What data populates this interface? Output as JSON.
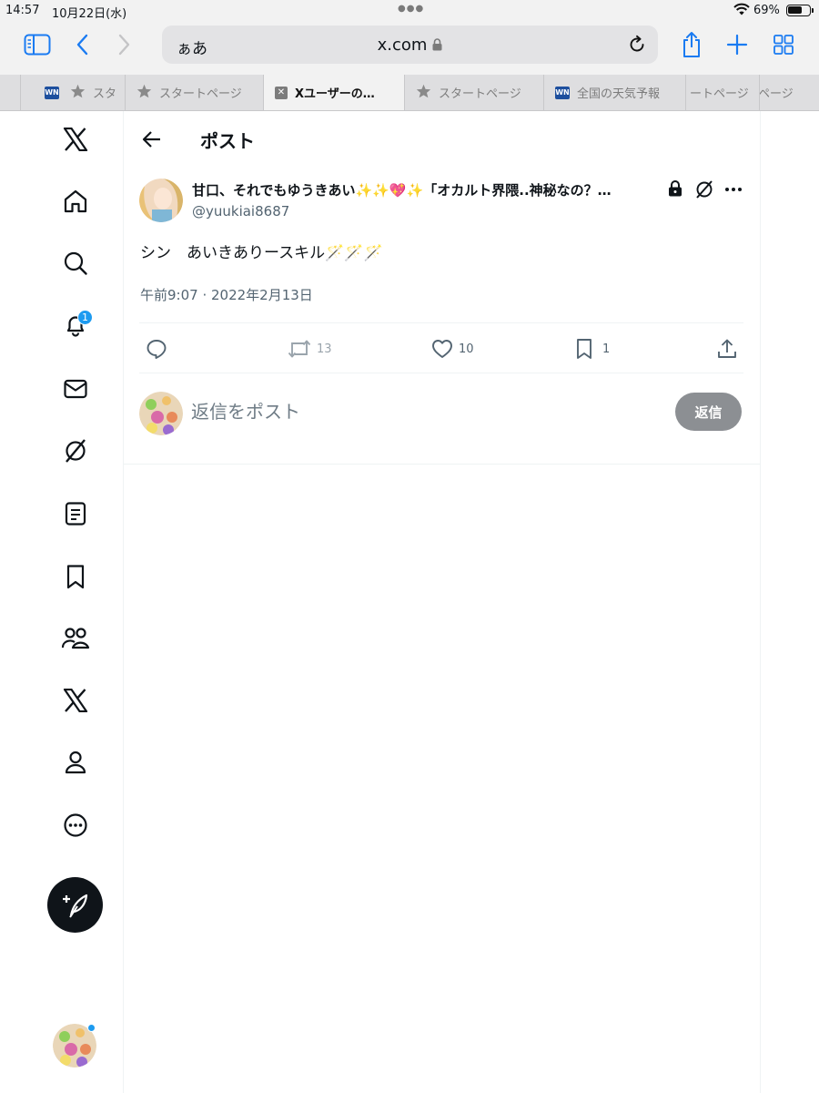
{
  "status_bar": {
    "time": "14:57",
    "date": "10月22日(水)",
    "battery_percent": "69%",
    "battery_level": 0.69
  },
  "browser": {
    "text_size_label": "ぁあ",
    "url": "x.com",
    "tabs": [
      {
        "label": "スタ",
        "favicon": "wn-icon"
      },
      {
        "label": "スタートページ",
        "favicon": "star-icon"
      },
      {
        "label": "Xユーザーの…",
        "favicon": "x-tab-icon",
        "active": true
      },
      {
        "label": "スタートページ",
        "favicon": "star-icon"
      },
      {
        "label": "全国の天気予報",
        "favicon": "wn-icon"
      },
      {
        "label": "ートページ",
        "favicon": ""
      },
      {
        "label": "ページ",
        "favicon": ""
      }
    ]
  },
  "sidebar": {
    "notification_count": "1",
    "items": [
      "home-icon",
      "search-icon",
      "bell-icon",
      "mail-icon",
      "grok-icon",
      "lists-icon",
      "bookmark-icon",
      "communities-icon",
      "premium-icon",
      "profile-icon",
      "more-icon"
    ]
  },
  "header": {
    "title": "ポスト"
  },
  "post": {
    "author_name": "甘口、それでもゆうきあい✨✨💖✨「オカルト界隈..神秘なの？…",
    "handle": "@yuukiai8687",
    "text": "シン　あいきありースキル🪄🪄🪄",
    "timestamp": "午前9:07 · 2022年2月13日",
    "actions": {
      "reply_count": "",
      "repost_count": "13",
      "like_count": "10",
      "bookmark_count": "1"
    }
  },
  "reply": {
    "placeholder": "返信をポスト",
    "button_label": "返信"
  },
  "colors": {
    "accent": "#1d9bf0",
    "text_primary": "#0f1419",
    "text_secondary": "#536471",
    "reply_button": "#8c8f93"
  }
}
